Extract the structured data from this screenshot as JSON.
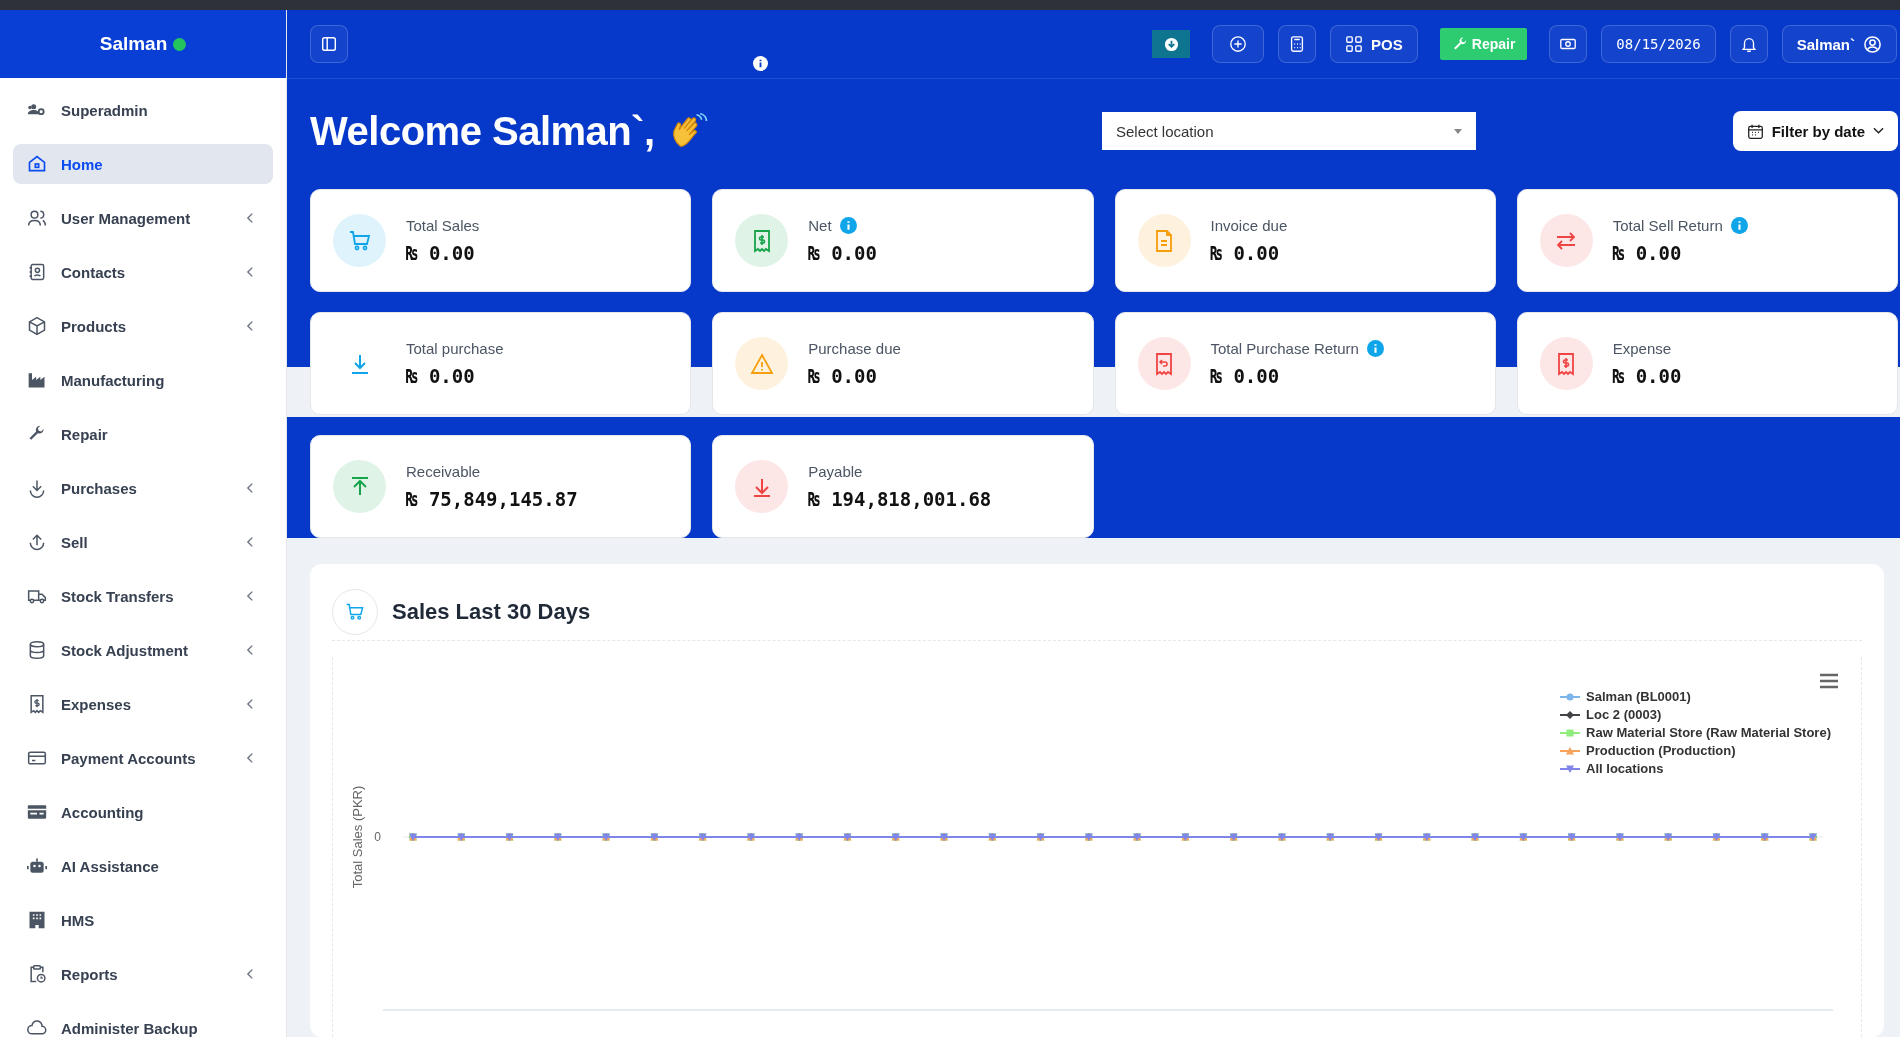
{
  "brand": {
    "name": "Salman",
    "online": true
  },
  "sidebar": {
    "items": [
      {
        "label": "Superadmin",
        "selected": false,
        "has_submenu": false
      },
      {
        "label": "Home",
        "selected": true,
        "has_submenu": false
      },
      {
        "label": "User Management",
        "selected": false,
        "has_submenu": true
      },
      {
        "label": "Contacts",
        "selected": false,
        "has_submenu": true
      },
      {
        "label": "Products",
        "selected": false,
        "has_submenu": true
      },
      {
        "label": "Manufacturing",
        "selected": false,
        "has_submenu": false
      },
      {
        "label": "Repair",
        "selected": false,
        "has_submenu": false
      },
      {
        "label": "Purchases",
        "selected": false,
        "has_submenu": true
      },
      {
        "label": "Sell",
        "selected": false,
        "has_submenu": true
      },
      {
        "label": "Stock Transfers",
        "selected": false,
        "has_submenu": true
      },
      {
        "label": "Stock Adjustment",
        "selected": false,
        "has_submenu": true
      },
      {
        "label": "Expenses",
        "selected": false,
        "has_submenu": true
      },
      {
        "label": "Payment Accounts",
        "selected": false,
        "has_submenu": true
      },
      {
        "label": "Accounting",
        "selected": false,
        "has_submenu": false
      },
      {
        "label": "AI Assistance",
        "selected": false,
        "has_submenu": false
      },
      {
        "label": "HMS",
        "selected": false,
        "has_submenu": false
      },
      {
        "label": "Reports",
        "selected": false,
        "has_submenu": true
      },
      {
        "label": "Administer Backup",
        "selected": false,
        "has_submenu": false
      }
    ]
  },
  "topbar": {
    "pos_label": "POS",
    "repair_label": "Repair",
    "date": "08/15/2026",
    "user": "Salman`"
  },
  "welcome": "Welcome Salman`,",
  "location_select": {
    "placeholder": "Select location"
  },
  "filter_button": "Filter by date",
  "stats": [
    {
      "label": "Total Sales",
      "value": "₨ 0.00",
      "info": false,
      "color": "#0ea5e9"
    },
    {
      "label": "Net",
      "value": "₨ 0.00",
      "info": true,
      "color": "#16a34a"
    },
    {
      "label": "Invoice due",
      "value": "₨ 0.00",
      "info": false,
      "color": "#f59e0b"
    },
    {
      "label": "Total Sell Return",
      "value": "₨ 0.00",
      "info": true,
      "color": "#ef4444"
    },
    {
      "label": "Total purchase",
      "value": "₨ 0.00",
      "info": false,
      "color": "#0ea5e9"
    },
    {
      "label": "Purchase due",
      "value": "₨ 0.00",
      "info": false,
      "color": "#f59e0b"
    },
    {
      "label": "Total Purchase Return",
      "value": "₨ 0.00",
      "info": true,
      "color": "#ef4444"
    },
    {
      "label": "Expense",
      "value": "₨ 0.00",
      "info": false,
      "color": "#ef4444"
    },
    {
      "label": "Receivable",
      "value": "₨ 75,849,145.87",
      "info": false,
      "color": "#16a34a"
    },
    {
      "label": "Payable",
      "value": "₨ 194,818,001.68",
      "info": false,
      "color": "#ef4444"
    }
  ],
  "chart_panel": {
    "title": "Sales Last 30 Days",
    "y_axis_label": "Total Sales (PKR)",
    "y_tick": "0",
    "legend": [
      {
        "name": "Salman (BL0001)",
        "color": "#7cb5ec"
      },
      {
        "name": "Loc 2 (0003)",
        "color": "#434348"
      },
      {
        "name": "Raw Material Store (Raw Material Store)",
        "color": "#90ed7d"
      },
      {
        "name": "Production (Production)",
        "color": "#f7a35c"
      },
      {
        "name": "All locations",
        "color": "#8085e9"
      }
    ]
  }
}
